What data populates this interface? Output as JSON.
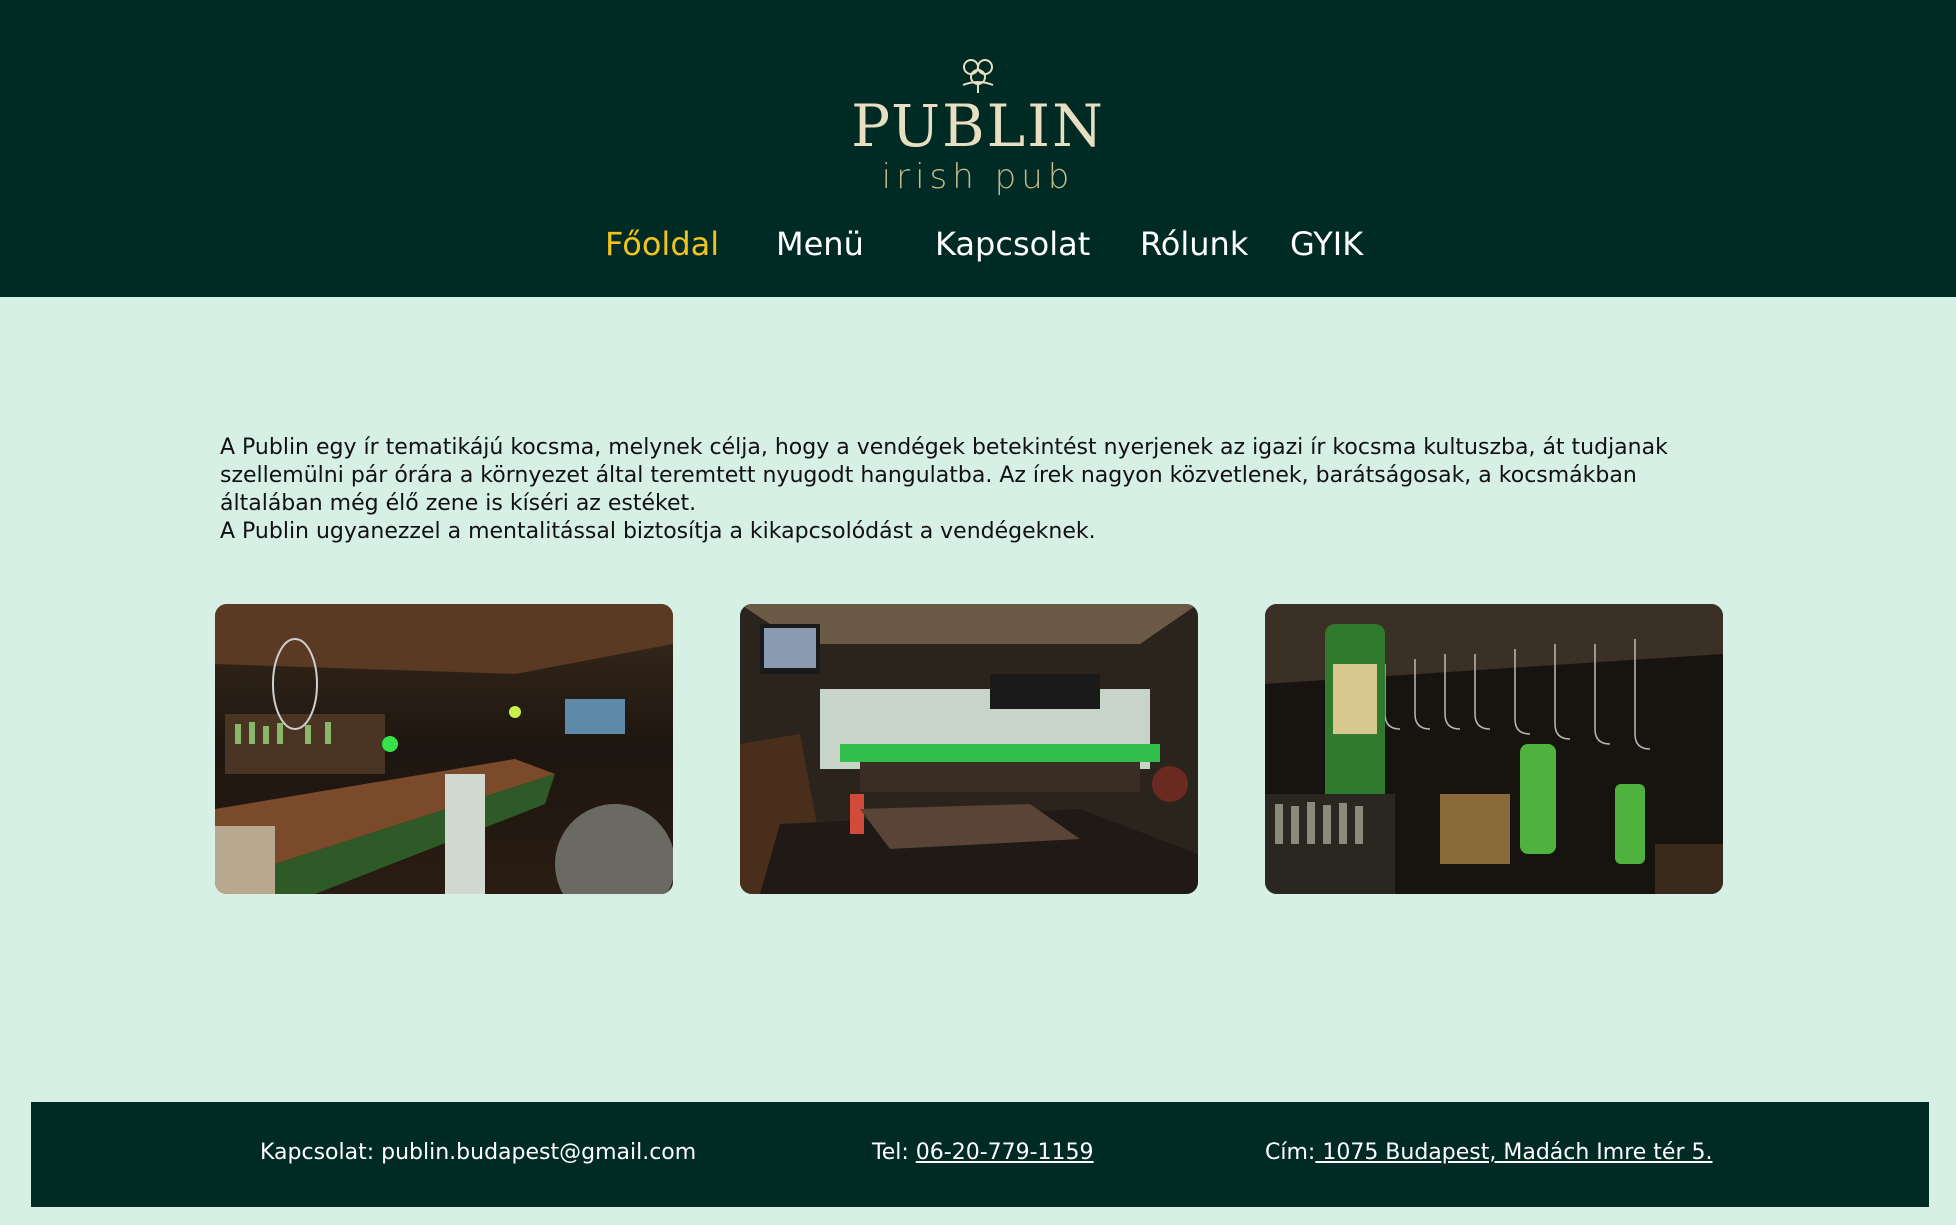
{
  "brand": {
    "name": "PUBLIN",
    "tagline": "irish pub",
    "logo_icon": "shamrock-icon"
  },
  "nav": {
    "items": [
      {
        "label": "Főoldal",
        "active": true
      },
      {
        "label": "Menü",
        "active": false
      },
      {
        "label": "Kapcsolat",
        "active": false
      },
      {
        "label": "Rólunk",
        "active": false
      },
      {
        "label": "GYIK",
        "active": false
      }
    ]
  },
  "intro": {
    "paragraph_1": "A  Publin egy ír tematikájú kocsma, melynek célja, hogy a vendégek betekintést nyerjenek az igazi ír kocsma kultuszba,  át tudjanak szellemülni pár órára a környezet által  teremtett nyugodt hangulatba. Az írek nagyon közvetlenek, barátságosak, a kocsmákban általában még élő zene is kíséri az estéket.",
    "paragraph_2": "A Publin ugyanezzel a mentalitással biztosítja a kikapcsolódást a vendégeknek."
  },
  "gallery": [
    {
      "subject": "bar-counter-photo"
    },
    {
      "subject": "seating-area-photo"
    },
    {
      "subject": "bottles-and-glasses-photo"
    }
  ],
  "footer": {
    "contact_label": "Kapcsolat: publin.budapest@gmail.com",
    "phone_prefix": "Tel: ",
    "phone": "06-20-779-1159",
    "address_prefix": "Cím:",
    "address": " 1075 Budapest, Madách Imre tér 5."
  },
  "colors": {
    "header_bg": "#002b24",
    "page_bg": "#d6f0e6",
    "active_nav": "#f2c21f",
    "logo_text": "#e8dfc2"
  }
}
